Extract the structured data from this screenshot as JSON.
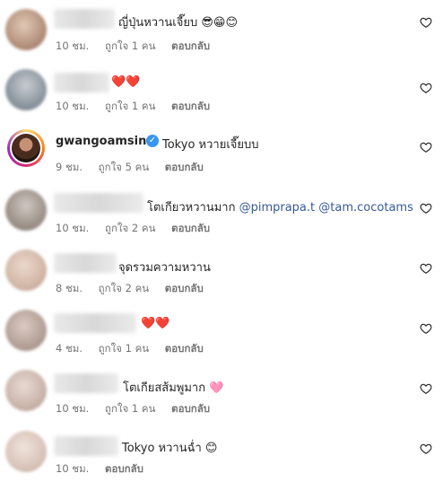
{
  "comments": [
    {
      "text": "ญี่ปุ่นหวานเจี๊ยบ 😎😁😊",
      "time": "10 ชม.",
      "likes": "ถูกใจ 1 คน",
      "reply": "ตอบกลับ"
    },
    {
      "text": "❤️❤️",
      "time": "10 ชม.",
      "likes": "ถูกใจ 1 คน",
      "reply": "ตอบกลับ"
    },
    {
      "username": "gwangoamsinn",
      "text": "Tokyo หวายเจี๊ยบบ",
      "time": "9 ชม.",
      "likes": "ถูกใจ 5 คน",
      "reply": "ตอบกลับ"
    },
    {
      "text": "โตเกียวหวานมาก",
      "mentions": [
        "@pimprapa.t",
        "@tam.cocotams"
      ],
      "time": "10 ชม.",
      "likes": "ถูกใจ 2 คน",
      "reply": "ตอบกลับ"
    },
    {
      "text": "จุดรวมความหวาน",
      "time": "8 ชม.",
      "likes": "ถูกใจ 2 คน",
      "reply": "ตอบกลับ"
    },
    {
      "text": "❤️❤️",
      "time": "4 ชม.",
      "likes": "ถูกใจ 1 คน",
      "reply": "ตอบกลับ"
    },
    {
      "text": "โตเกียสส้มพูมาก 🩷",
      "time": "10 ชม.",
      "likes": "ถูกใจ 1 คน",
      "reply": "ตอบกลับ"
    },
    {
      "text": "Tokyo หวานฉ่ำ 😊",
      "time": "10 ชม.",
      "reply": "ตอบกลับ"
    }
  ],
  "icons": {
    "like": "heart-outline-icon",
    "verified": "verified-badge-icon"
  }
}
